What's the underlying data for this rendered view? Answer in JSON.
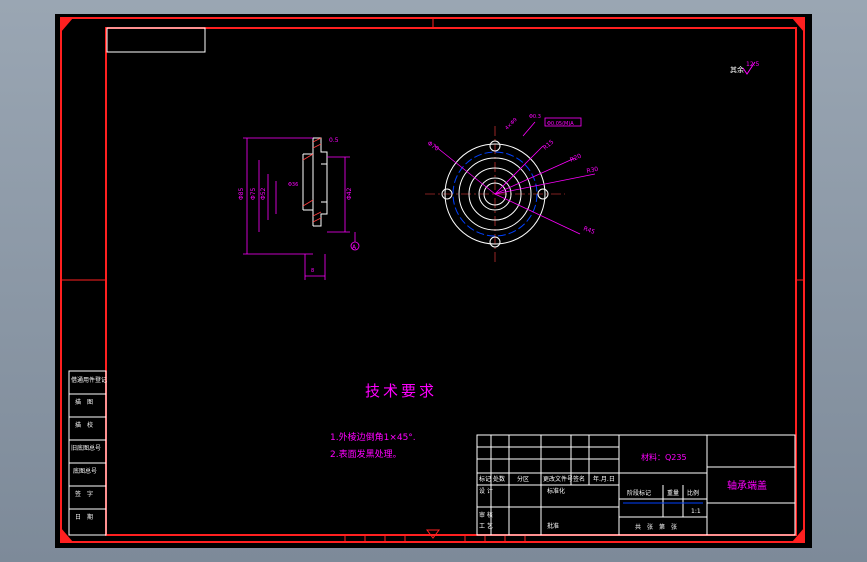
{
  "drawing": {
    "title": "轴承端盖",
    "material": "材料：Q235",
    "scale": "1:1",
    "surface_finish": "其余",
    "roughness": "12.5",
    "tech_requirements": {
      "heading": "技术要求",
      "items": [
        "1.外棱边倒角1×45°.",
        "2.表面发黑处理。"
      ]
    },
    "side_view_labels": {
      "d1": "Φ85",
      "d2": "Φ75",
      "d3": "Φ52",
      "d4": "Φ42",
      "d5": "Φ36",
      "chamfer": "0.5",
      "t1": "5",
      "t2": "8",
      "datum": "A",
      "ref": "12.5"
    },
    "front_view_labels": {
      "r1": "R30",
      "r2": "R20",
      "r3": "R15",
      "r4": "R42",
      "r5": "R45",
      "holes": "4×Φ9",
      "angle": "R8",
      "pitch": "Φ70",
      "tolerance": "Φ0.05(M)A",
      "ref": "Φ0.3"
    }
  },
  "left_table": [
    "借通用件登记",
    "描　图",
    "描　校",
    "旧底图总号",
    "底图总号",
    "签　字",
    "日　期"
  ],
  "title_block": {
    "row_labels": [
      "标记",
      "处数",
      "分区",
      "更改文件号",
      "签名",
      "年.月.日"
    ],
    "design": "设 计",
    "std": "标准化",
    "stage": "阶段标记",
    "weight": "重量",
    "ratio": "比例",
    "review": "审 核",
    "process": "工 艺",
    "approve": "批准",
    "sheets": "共　张　第　张"
  }
}
